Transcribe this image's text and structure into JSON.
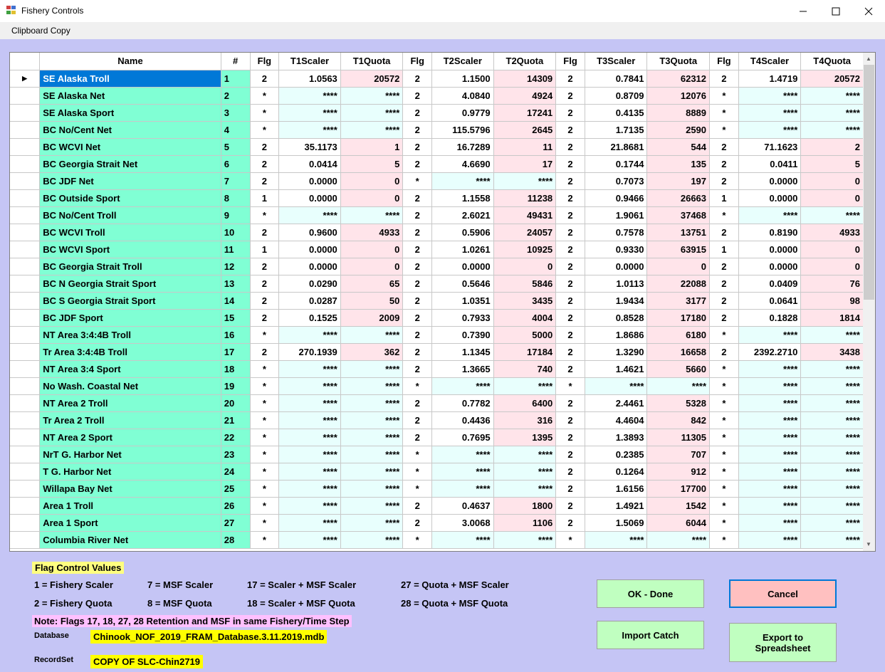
{
  "window": {
    "title": "Fishery Controls"
  },
  "menu": {
    "clipboard_copy": "Clipboard Copy"
  },
  "grid": {
    "columns": [
      "Name",
      "#",
      "Flg",
      "T1Scaler",
      "T1Quota",
      "Flg",
      "T2Scaler",
      "T2Quota",
      "Flg",
      "T3Scaler",
      "T3Quota",
      "Flg",
      "T4Scaler",
      "T4Quota"
    ],
    "selected_row_marker": "▶",
    "rows": [
      {
        "name": "SE Alaska Troll",
        "num": "1",
        "f1": "2",
        "s1": "1.0563",
        "q1": "20572",
        "f2": "2",
        "s2": "1.1500",
        "q2": "14309",
        "f3": "2",
        "s3": "0.7841",
        "q3": "62312",
        "f4": "2",
        "s4": "1.4719",
        "q4": "20572"
      },
      {
        "name": "SE Alaska Net",
        "num": "2",
        "f1": "*",
        "s1": "****",
        "q1": "****",
        "f2": "2",
        "s2": "4.0840",
        "q2": "4924",
        "f3": "2",
        "s3": "0.8709",
        "q3": "12076",
        "f4": "*",
        "s4": "****",
        "q4": "****"
      },
      {
        "name": "SE Alaska Sport",
        "num": "3",
        "f1": "*",
        "s1": "****",
        "q1": "****",
        "f2": "2",
        "s2": "0.9779",
        "q2": "17241",
        "f3": "2",
        "s3": "0.4135",
        "q3": "8889",
        "f4": "*",
        "s4": "****",
        "q4": "****"
      },
      {
        "name": "BC No/Cent Net",
        "num": "4",
        "f1": "*",
        "s1": "****",
        "q1": "****",
        "f2": "2",
        "s2": "115.5796",
        "q2": "2645",
        "f3": "2",
        "s3": "1.7135",
        "q3": "2590",
        "f4": "*",
        "s4": "****",
        "q4": "****"
      },
      {
        "name": "BC WCVI Net",
        "num": "5",
        "f1": "2",
        "s1": "35.1173",
        "q1": "1",
        "f2": "2",
        "s2": "16.7289",
        "q2": "11",
        "f3": "2",
        "s3": "21.8681",
        "q3": "544",
        "f4": "2",
        "s4": "71.1623",
        "q4": "2"
      },
      {
        "name": "BC Georgia Strait Net",
        "num": "6",
        "f1": "2",
        "s1": "0.0414",
        "q1": "5",
        "f2": "2",
        "s2": "4.6690",
        "q2": "17",
        "f3": "2",
        "s3": "0.1744",
        "q3": "135",
        "f4": "2",
        "s4": "0.0411",
        "q4": "5"
      },
      {
        "name": "BC JDF Net",
        "num": "7",
        "f1": "2",
        "s1": "0.0000",
        "q1": "0",
        "f2": "*",
        "s2": "****",
        "q2": "****",
        "f3": "2",
        "s3": "0.7073",
        "q3": "197",
        "f4": "2",
        "s4": "0.0000",
        "q4": "0"
      },
      {
        "name": "BC Outside Sport",
        "num": "8",
        "f1": "1",
        "s1": "0.0000",
        "q1": "0",
        "f2": "2",
        "s2": "1.1558",
        "q2": "11238",
        "f3": "2",
        "s3": "0.9466",
        "q3": "26663",
        "f4": "1",
        "s4": "0.0000",
        "q4": "0"
      },
      {
        "name": "BC No/Cent Troll",
        "num": "9",
        "f1": "*",
        "s1": "****",
        "q1": "****",
        "f2": "2",
        "s2": "2.6021",
        "q2": "49431",
        "f3": "2",
        "s3": "1.9061",
        "q3": "37468",
        "f4": "*",
        "s4": "****",
        "q4": "****"
      },
      {
        "name": "BC WCVI Troll",
        "num": "10",
        "f1": "2",
        "s1": "0.9600",
        "q1": "4933",
        "f2": "2",
        "s2": "0.5906",
        "q2": "24057",
        "f3": "2",
        "s3": "0.7578",
        "q3": "13751",
        "f4": "2",
        "s4": "0.8190",
        "q4": "4933"
      },
      {
        "name": "BC WCVI Sport",
        "num": "11",
        "f1": "1",
        "s1": "0.0000",
        "q1": "0",
        "f2": "2",
        "s2": "1.0261",
        "q2": "10925",
        "f3": "2",
        "s3": "0.9330",
        "q3": "63915",
        "f4": "1",
        "s4": "0.0000",
        "q4": "0"
      },
      {
        "name": "BC Georgia Strait Troll",
        "num": "12",
        "f1": "2",
        "s1": "0.0000",
        "q1": "0",
        "f2": "2",
        "s2": "0.0000",
        "q2": "0",
        "f3": "2",
        "s3": "0.0000",
        "q3": "0",
        "f4": "2",
        "s4": "0.0000",
        "q4": "0"
      },
      {
        "name": "BC N Georgia Strait Sport",
        "num": "13",
        "f1": "2",
        "s1": "0.0290",
        "q1": "65",
        "f2": "2",
        "s2": "0.5646",
        "q2": "5846",
        "f3": "2",
        "s3": "1.0113",
        "q3": "22088",
        "f4": "2",
        "s4": "0.0409",
        "q4": "76"
      },
      {
        "name": "BC S Georgia Strait Sport",
        "num": "14",
        "f1": "2",
        "s1": "0.0287",
        "q1": "50",
        "f2": "2",
        "s2": "1.0351",
        "q2": "3435",
        "f3": "2",
        "s3": "1.9434",
        "q3": "3177",
        "f4": "2",
        "s4": "0.0641",
        "q4": "98"
      },
      {
        "name": "BC JDF Sport",
        "num": "15",
        "f1": "2",
        "s1": "0.1525",
        "q1": "2009",
        "f2": "2",
        "s2": "0.7933",
        "q2": "4004",
        "f3": "2",
        "s3": "0.8528",
        "q3": "17180",
        "f4": "2",
        "s4": "0.1828",
        "q4": "1814"
      },
      {
        "name": "NT Area 3:4:4B Troll",
        "num": "16",
        "f1": "*",
        "s1": "****",
        "q1": "****",
        "f2": "2",
        "s2": "0.7390",
        "q2": "5000",
        "f3": "2",
        "s3": "1.8686",
        "q3": "6180",
        "f4": "*",
        "s4": "****",
        "q4": "****"
      },
      {
        "name": "Tr Area 3:4:4B Troll",
        "num": "17",
        "f1": "2",
        "s1": "270.1939",
        "q1": "362",
        "f2": "2",
        "s2": "1.1345",
        "q2": "17184",
        "f3": "2",
        "s3": "1.3290",
        "q3": "16658",
        "f4": "2",
        "s4": "2392.2710",
        "q4": "3438"
      },
      {
        "name": "NT Area 3:4 Sport",
        "num": "18",
        "f1": "*",
        "s1": "****",
        "q1": "****",
        "f2": "2",
        "s2": "1.3665",
        "q2": "740",
        "f3": "2",
        "s3": "1.4621",
        "q3": "5660",
        "f4": "*",
        "s4": "****",
        "q4": "****"
      },
      {
        "name": "No Wash. Coastal Net",
        "num": "19",
        "f1": "*",
        "s1": "****",
        "q1": "****",
        "f2": "*",
        "s2": "****",
        "q2": "****",
        "f3": "*",
        "s3": "****",
        "q3": "****",
        "f4": "*",
        "s4": "****",
        "q4": "****"
      },
      {
        "name": "NT Area 2 Troll",
        "num": "20",
        "f1": "*",
        "s1": "****",
        "q1": "****",
        "f2": "2",
        "s2": "0.7782",
        "q2": "6400",
        "f3": "2",
        "s3": "2.4461",
        "q3": "5328",
        "f4": "*",
        "s4": "****",
        "q4": "****"
      },
      {
        "name": "Tr Area 2 Troll",
        "num": "21",
        "f1": "*",
        "s1": "****",
        "q1": "****",
        "f2": "2",
        "s2": "0.4436",
        "q2": "316",
        "f3": "2",
        "s3": "4.4604",
        "q3": "842",
        "f4": "*",
        "s4": "****",
        "q4": "****"
      },
      {
        "name": "NT Area 2 Sport",
        "num": "22",
        "f1": "*",
        "s1": "****",
        "q1": "****",
        "f2": "2",
        "s2": "0.7695",
        "q2": "1395",
        "f3": "2",
        "s3": "1.3893",
        "q3": "11305",
        "f4": "*",
        "s4": "****",
        "q4": "****"
      },
      {
        "name": "NrT G. Harbor Net",
        "num": "23",
        "f1": "*",
        "s1": "****",
        "q1": "****",
        "f2": "*",
        "s2": "****",
        "q2": "****",
        "f3": "2",
        "s3": "0.2385",
        "q3": "707",
        "f4": "*",
        "s4": "****",
        "q4": "****"
      },
      {
        "name": "T G. Harbor Net",
        "num": "24",
        "f1": "*",
        "s1": "****",
        "q1": "****",
        "f2": "*",
        "s2": "****",
        "q2": "****",
        "f3": "2",
        "s3": "0.1264",
        "q3": "912",
        "f4": "*",
        "s4": "****",
        "q4": "****"
      },
      {
        "name": "Willapa Bay Net",
        "num": "25",
        "f1": "*",
        "s1": "****",
        "q1": "****",
        "f2": "*",
        "s2": "****",
        "q2": "****",
        "f3": "2",
        "s3": "1.6156",
        "q3": "17700",
        "f4": "*",
        "s4": "****",
        "q4": "****"
      },
      {
        "name": "Area 1 Troll",
        "num": "26",
        "f1": "*",
        "s1": "****",
        "q1": "****",
        "f2": "2",
        "s2": "0.4637",
        "q2": "1800",
        "f3": "2",
        "s3": "1.4921",
        "q3": "1542",
        "f4": "*",
        "s4": "****",
        "q4": "****"
      },
      {
        "name": "Area 1 Sport",
        "num": "27",
        "f1": "*",
        "s1": "****",
        "q1": "****",
        "f2": "2",
        "s2": "3.0068",
        "q2": "1106",
        "f3": "2",
        "s3": "1.5069",
        "q3": "6044",
        "f4": "*",
        "s4": "****",
        "q4": "****"
      },
      {
        "name": "Columbia River Net",
        "num": "28",
        "f1": "*",
        "s1": "****",
        "q1": "****",
        "f2": "*",
        "s2": "****",
        "q2": "****",
        "f3": "*",
        "s3": "****",
        "q3": "****",
        "f4": "*",
        "s4": "****",
        "q4": "****"
      }
    ]
  },
  "legend": {
    "title": "Flag Control Values",
    "items": [
      "1 = Fishery Scaler",
      "7 = MSF Scaler",
      "17 = Scaler + MSF Scaler",
      "27 = Quota + MSF Scaler",
      "2 = Fishery Quota",
      "8 = MSF Quota",
      "18 = Scaler + MSF Quota",
      "28 = Quota + MSF Quota"
    ],
    "note": "Note: Flags 17, 18, 27, 28 Retention and MSF in same Fishery/Time Step"
  },
  "database": {
    "label": "Database",
    "value": "Chinook_NOF_2019_FRAM_Database.3.11.2019.mdb"
  },
  "recordset": {
    "label": "RecordSet",
    "value": "COPY OF SLC-Chin2719"
  },
  "buttons": {
    "ok": "OK - Done",
    "cancel": "Cancel",
    "import": "Import Catch",
    "export": "Export to Spreadsheet"
  },
  "colors": {
    "form_bg": "#c5c5f5",
    "name_col": "#80ffd4",
    "selected": "#0078d7",
    "quota_active": "#ffe4ea",
    "inactive": "#e8fffd",
    "legend_yellow": "#ffff80",
    "note_pink": "#ffc0ff",
    "btn_green": "#c0ffc0",
    "btn_red": "#ffc0c0"
  },
  "icons": {
    "app": "app-grid-icon",
    "minimize": "minimize-icon",
    "maximize": "maximize-icon",
    "close": "close-icon"
  }
}
